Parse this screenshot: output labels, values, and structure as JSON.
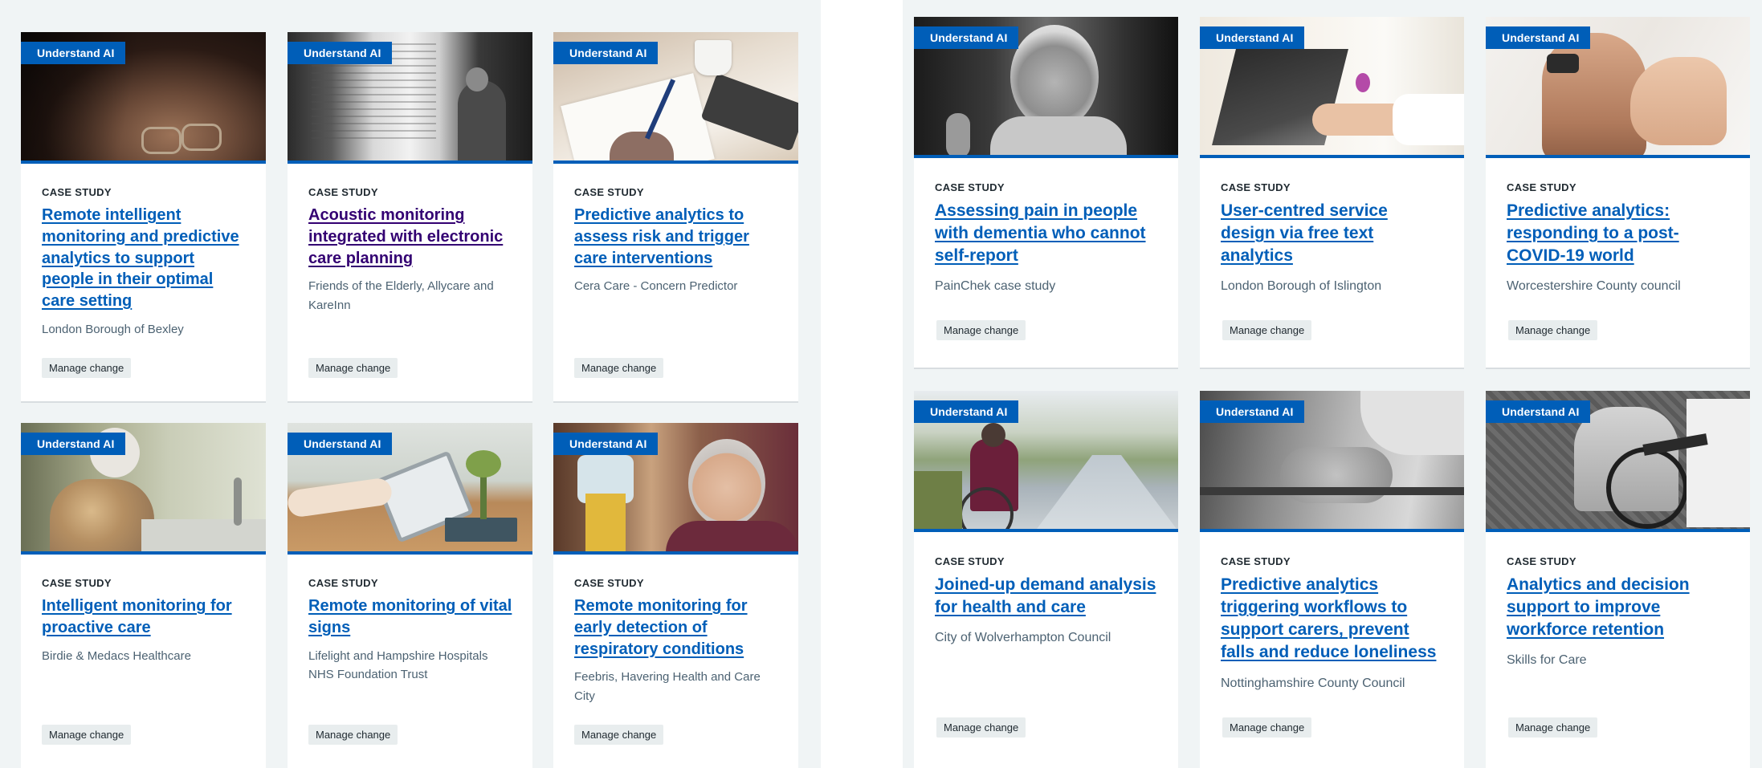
{
  "tag_label": "Understand AI",
  "kicker_label": "CASE STUDY",
  "badge_label": "Manage change",
  "colors": {
    "brand_blue": "#005eb8",
    "visited_purple": "#330072",
    "panel_bg": "#f0f4f5",
    "badge_bg": "#e8edee"
  },
  "left_cards": [
    {
      "title": "Remote intelligent monitoring and predictive analytics to support people in their optimal care setting",
      "org": "London Borough of Bexley",
      "image": "older-woman-glasses-photo"
    },
    {
      "title": "Acoustic monitoring integrated with electronic care planning",
      "org": "Friends of the Elderly, Allycare and KareInn",
      "image": "man-at-window-photo"
    },
    {
      "title": "Predictive analytics to assess risk and trigger care interventions",
      "org": "Cera Care - Concern Predictor",
      "image": "writing-notes-photo"
    },
    {
      "title": "Intelligent monitoring for proactive care",
      "org": "Birdie & Medacs Healthcare",
      "image": "woman-at-sink-photo"
    },
    {
      "title": "Remote monitoring of vital signs",
      "org": "Lifelight and Hampshire Hospitals NHS Foundation Trust",
      "image": "tablet-on-table-photo"
    },
    {
      "title": "Remote monitoring for early detection of respiratory conditions",
      "org": "Feebris, Havering Health and Care City",
      "image": "smiling-older-woman-photo"
    }
  ],
  "right_cards": [
    {
      "title": "Assessing pain in people with dementia who cannot self-report",
      "org": "PainChek case study",
      "image": "older-woman-bw-photo"
    },
    {
      "title": "User-centred service design via free text analytics",
      "org": "London Borough of Islington",
      "image": "laptop-hands-photo"
    },
    {
      "title": "Predictive analytics: responding to a post-COVID-19 world",
      "org": "Worcestershire County council",
      "image": "holding-hands-photo"
    },
    {
      "title": "Joined-up demand analysis for health and care",
      "org": "City of Wolverhampton Council",
      "image": "wheelchair-street-photo"
    },
    {
      "title": "Predictive analytics triggering workflows to support carers, prevent falls and reduce loneliness",
      "org": "Nottinghamshire County Council",
      "image": "hands-on-wheelchair-photo"
    },
    {
      "title": "Analytics and decision support to improve workforce retention",
      "org": "Skills for Care",
      "image": "pushing-wheelchair-photo"
    }
  ]
}
